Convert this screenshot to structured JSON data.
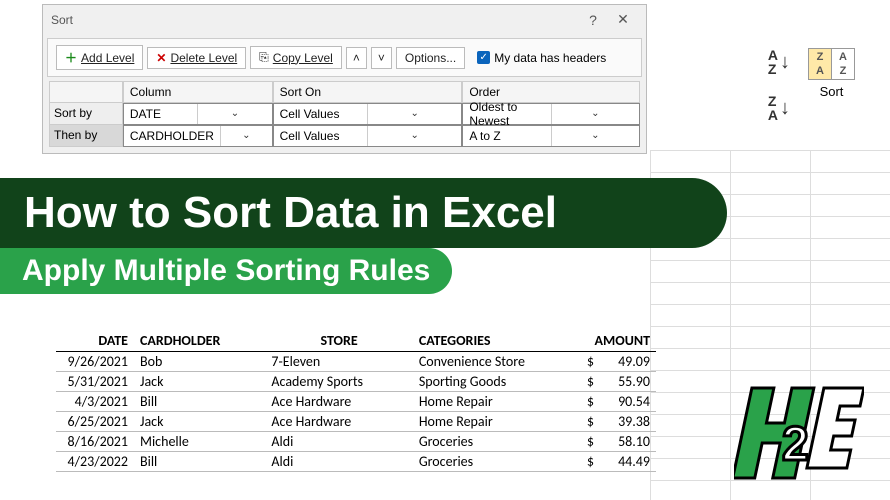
{
  "dialog": {
    "title": "Sort",
    "buttons": {
      "add": "Add Level",
      "delete": "Delete Level",
      "copy": "Copy Level",
      "options": "Options..."
    },
    "checkbox_label": "My data has headers",
    "headers": {
      "column": "Column",
      "sorton": "Sort On",
      "order": "Order"
    },
    "rules": [
      {
        "label": "Sort by",
        "column": "DATE",
        "sorton": "Cell Values",
        "order": "Oldest to Newest"
      },
      {
        "label": "Then by",
        "column": "CARDHOLDER",
        "sorton": "Cell Values",
        "order": "A to Z"
      }
    ]
  },
  "ribbon": {
    "az": {
      "top": "A",
      "bottom": "Z"
    },
    "za": {
      "top": "Z",
      "bottom": "A"
    },
    "sort_label": "Sort"
  },
  "banner": {
    "line1": "How to Sort Data in Excel",
    "line2": "Apply Multiple Sorting Rules"
  },
  "table": {
    "headers": {
      "date": "DATE",
      "cardholder": "CARDHOLDER",
      "store": "STORE",
      "categories": "CATEGORIES",
      "amount": "AMOUNT"
    },
    "rows": [
      {
        "date": "9/26/2021",
        "cardholder": "Bob",
        "store": "7-Eleven",
        "categories": "Convenience Store",
        "amount": "49.09"
      },
      {
        "date": "5/31/2021",
        "cardholder": "Jack",
        "store": "Academy Sports",
        "categories": "Sporting Goods",
        "amount": "55.90"
      },
      {
        "date": "4/3/2021",
        "cardholder": "Bill",
        "store": "Ace Hardware",
        "categories": "Home Repair",
        "amount": "90.54"
      },
      {
        "date": "6/25/2021",
        "cardholder": "Jack",
        "store": "Ace Hardware",
        "categories": "Home Repair",
        "amount": "39.38"
      },
      {
        "date": "8/16/2021",
        "cardholder": "Michelle",
        "store": "Aldi",
        "categories": "Groceries",
        "amount": "58.10"
      },
      {
        "date": "4/23/2022",
        "cardholder": "Bill",
        "store": "Aldi",
        "categories": "Groceries",
        "amount": "44.49"
      }
    ],
    "currency": "$"
  }
}
